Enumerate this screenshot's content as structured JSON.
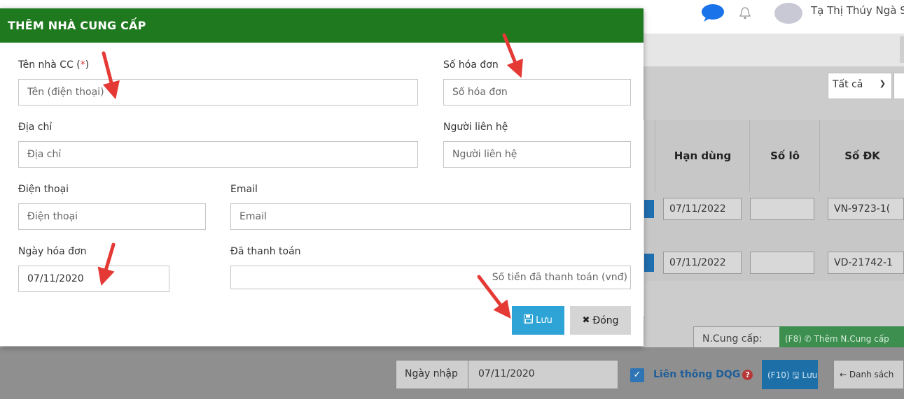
{
  "modal": {
    "title": "THÊM NHÀ CUNG CẤP",
    "fields": {
      "ten_ncc": {
        "label": "Tên nhà CC (",
        "required_mark": "*",
        "label_suffix": ")",
        "placeholder": "Tên (điện thoại)"
      },
      "so_hoa_don": {
        "label": "Số hóa đơn",
        "placeholder": "Số hóa đơn"
      },
      "dia_chi": {
        "label": "Địa chỉ",
        "placeholder": "Địa chỉ"
      },
      "nguoi_lien_he": {
        "label": "Người liên hệ",
        "placeholder": "Người liên hệ"
      },
      "dien_thoai": {
        "label": "Điện thoại",
        "placeholder": "Điện thoại"
      },
      "email": {
        "label": "Email",
        "placeholder": "Email"
      },
      "ngay_hoa_don": {
        "label": "Ngày hóa đơn",
        "value": "07/11/2020"
      },
      "da_thanh_toan": {
        "label": "Đã thanh toán",
        "placeholder": "Số tiền đã thanh toán (vnđ)"
      }
    },
    "buttons": {
      "save_label": "Lưu",
      "close_label": "Đóng"
    }
  },
  "background": {
    "user_name": "Tạ Thị Thúy Ngà S...",
    "filter_select_value": "Tất cả",
    "table_headers": [
      "Hạn dùng",
      "Số lô",
      "Số ĐK"
    ],
    "rows": [
      {
        "han_dung": "07/11/2022",
        "so_lo": "",
        "so_dk": "VN-9723-1("
      },
      {
        "han_dung": "07/11/2022",
        "so_lo": "",
        "so_dk": "VD-21742-1"
      }
    ],
    "ncungcap_label": "N.Cung cấp:",
    "them_ncungcap_label": "(F8) ✆ Thêm N.Cung cấp",
    "ngay_nhap_label": "Ngày nhập",
    "ngay_nhap_value": "07/11/2020",
    "lien_thong_label": "Liên thông DQG",
    "f10_label": "(F10) 🖫 Lưu",
    "danh_sach_label": "← Danh sách"
  },
  "icons": {
    "save": "floppy-disk-icon",
    "close": "x-icon",
    "help": "question-circle-icon",
    "check": "checkbox-checked-icon"
  },
  "colors": {
    "header_green": "#1f7a1f",
    "save_blue": "#2ea3d6",
    "close_gray": "#d5d5d5",
    "required_red": "#dd3333",
    "arrow_red": "#e53935"
  }
}
